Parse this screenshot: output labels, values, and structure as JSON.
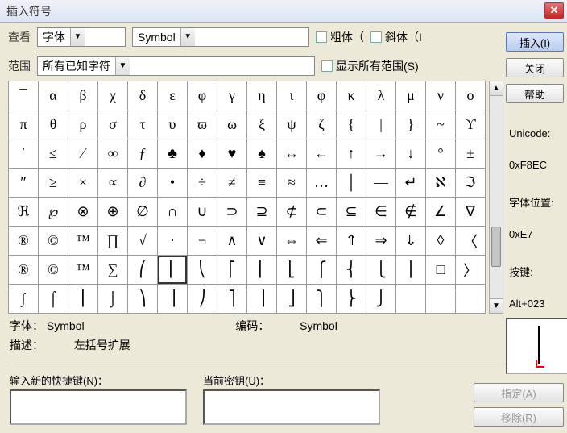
{
  "title": "插入符号",
  "labels": {
    "view": "查看",
    "range": "范围",
    "font_sel": "字体",
    "font_name": "Symbol",
    "range_val": "所有已知字符",
    "bold": "粗体（",
    "italic": "斜体（I",
    "show_all": "显示所有范围(S)",
    "font": "字体：",
    "encoding": "编码：",
    "desc": "描述：",
    "desc_val": "左括号扩展",
    "enc_val": "Symbol",
    "font_val": "Symbol",
    "shortcut_new": "输入新的快捷键(N)：",
    "shortcut_cur": "当前密钥(U)："
  },
  "buttons": {
    "insert": "插入(I)",
    "close": "关闭",
    "help": "帮助",
    "assign": "指定(A)",
    "remove": "移除(R)"
  },
  "side": {
    "unicode_lbl": "Unicode:",
    "unicode_val": "0xF8EC",
    "fontpos_lbl": "字体位置:",
    "fontpos_val": "0xE7",
    "key_lbl": "按键:",
    "key_val": "Alt+023"
  },
  "grid": {
    "rows": [
      [
        "¯",
        "α",
        "β",
        "χ",
        "δ",
        "ε",
        "φ",
        "γ",
        "η",
        "ι",
        "φ",
        "κ",
        "λ",
        "μ",
        "ν",
        "ο"
      ],
      [
        "π",
        "θ",
        "ρ",
        "σ",
        "τ",
        "υ",
        "ϖ",
        "ω",
        "ξ",
        "ψ",
        "ζ",
        "{",
        "|",
        "}",
        "~",
        "ϒ"
      ],
      [
        "′",
        "≤",
        "⁄",
        "∞",
        "ƒ",
        "♣",
        "♦",
        "♥",
        "♠",
        "↔",
        "←",
        "↑",
        "→",
        "↓",
        "°",
        "±"
      ],
      [
        "″",
        "≥",
        "×",
        "∝",
        "∂",
        "•",
        "÷",
        "≠",
        "≡",
        "≈",
        "…",
        "│",
        "—",
        "↵",
        "ℵ",
        "ℑ"
      ],
      [
        "ℜ",
        "℘",
        "⊗",
        "⊕",
        "∅",
        "∩",
        "∪",
        "⊃",
        "⊇",
        "⊄",
        "⊂",
        "⊆",
        "∈",
        "∉",
        "∠",
        "∇"
      ],
      [
        "®",
        "©",
        "™",
        "∏",
        "√",
        "·",
        "¬",
        "∧",
        "∨",
        "⇔",
        "⇐",
        "⇑",
        "⇒",
        "⇓",
        "◊",
        "〈"
      ],
      [
        "®",
        "©",
        "™",
        "∑",
        "⎛",
        "⎜",
        "⎝",
        "⎡",
        "⎢",
        "⎣",
        "⎧",
        "⎨",
        "⎩",
        "⎪",
        "□",
        "〉"
      ],
      [
        "∫",
        "⌠",
        "⎮",
        "⌡",
        "⎞",
        "⎟",
        "⎠",
        "⎤",
        "⎥",
        "⎦",
        "⎫",
        "⎬",
        "⎭",
        "",
        "",
        ""
      ]
    ],
    "selected": [
      6,
      5
    ]
  }
}
